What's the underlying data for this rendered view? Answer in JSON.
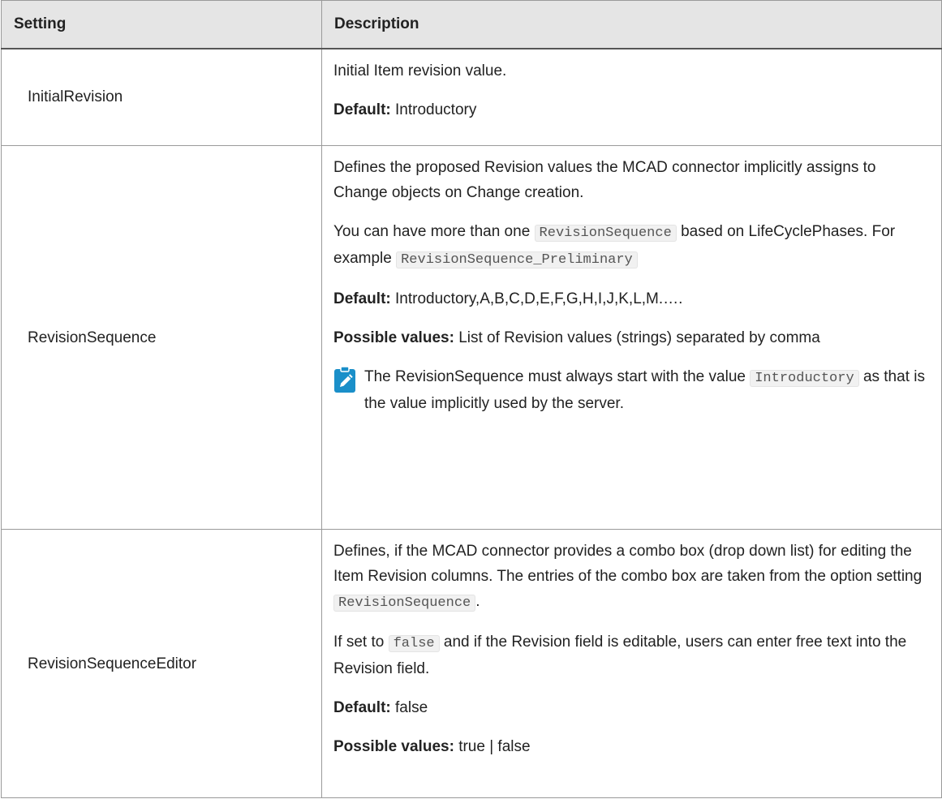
{
  "table": {
    "headers": {
      "setting": "Setting",
      "description": "Description"
    },
    "rows": [
      {
        "setting": "InitialRevision",
        "p1": "Initial Item revision value.",
        "default_label": "Default:",
        "default_value": "Introductory"
      },
      {
        "setting": "RevisionSequence",
        "p1": "Defines the proposed Revision values the MCAD connector implicitly assigns to Change objects on Change creation.",
        "p2_a": "You can have more than one",
        "p2_code": "RevisionSequence",
        "p2_b": "based on LifeCyclePhases. For example",
        "p2_code2": "RevisionSequence_Preliminary",
        "default_label": "Default:",
        "default_value": "Introductory,A,B,C,D,E,F,G,H,I,J,K,L,M.….",
        "possible_label": "Possible values:",
        "possible_value": "List of Revision values (strings) separated by comma",
        "note_a": "The RevisionSequence must always start with the value",
        "note_code": "Introductory",
        "note_b": "as that is the value implicitly used by the server.",
        "note_icon": "note-pencil-icon"
      },
      {
        "setting": "RevisionSequenceEditor",
        "p1_a": "Defines, if the MCAD connector provides a combo box (drop down list) for editing the Item Revision columns. The entries of the combo box are taken from the option setting",
        "p1_code": "RevisionSequence",
        "p1_b": ".",
        "p2_a": "If set to",
        "p2_code": "false",
        "p2_b": "and if the Revision field is editable, users can enter free text into the Revision field.",
        "default_label": "Default:",
        "default_value": "false",
        "possible_label": "Possible values:",
        "possible_value": "true | false"
      }
    ]
  },
  "colors": {
    "note_icon": "#1a8fc9",
    "header_bg": "#e5e5e5"
  }
}
